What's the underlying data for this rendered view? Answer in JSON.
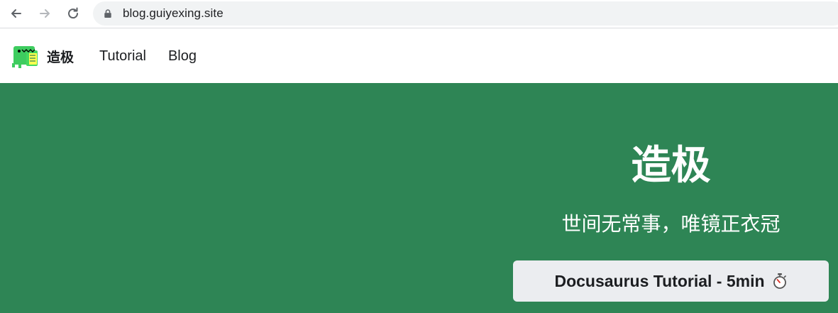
{
  "browser": {
    "url": "blog.guiyexing.site",
    "icons": [
      "back-arrow-icon",
      "forward-arrow-icon",
      "reload-icon",
      "lock-icon"
    ]
  },
  "navbar": {
    "brand_title": "造极",
    "logo_icon": "dinosaur-logo-icon",
    "links": [
      {
        "label": "Tutorial"
      },
      {
        "label": "Blog"
      }
    ]
  },
  "hero": {
    "title": "造极",
    "subtitle": "世间无常事，唯镜正衣冠",
    "cta_label": "Docusaurus Tutorial - 5min",
    "cta_icon": "stopwatch-icon"
  },
  "colors": {
    "hero_background": "#2e8555",
    "button_background": "#ebedf0",
    "text_dark": "#1c1e21",
    "omnibox_background": "#f1f3f4"
  }
}
